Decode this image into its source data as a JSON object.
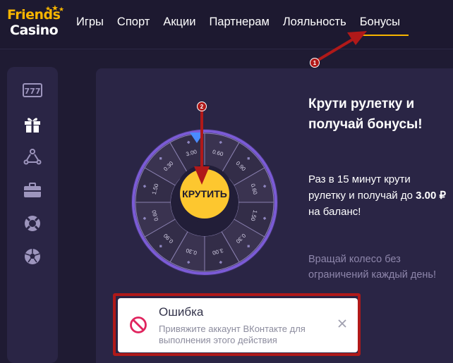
{
  "header": {
    "logo": {
      "line1": "Friends",
      "line2": "Casino"
    },
    "nav": [
      {
        "label": "Игры"
      },
      {
        "label": "Спорт"
      },
      {
        "label": "Акции"
      },
      {
        "label": "Партнерам"
      },
      {
        "label": "Лояльность"
      },
      {
        "label": "Бонусы",
        "active": true
      }
    ],
    "accent_color": "#f7b500"
  },
  "sidebar": {
    "items": [
      {
        "icon": "slots-777-icon"
      },
      {
        "icon": "gift-icon"
      },
      {
        "icon": "network-icon"
      },
      {
        "icon": "briefcase-icon"
      },
      {
        "icon": "lifebuoy-icon"
      },
      {
        "icon": "soccer-ball-icon"
      }
    ]
  },
  "wheel": {
    "spin_label": "КРУТИТЬ",
    "segments": [
      "0.60",
      "0.90",
      "0.60",
      "1.50",
      "0.30",
      "3.00",
      "0.30",
      "0.90",
      "0.60",
      "1.50",
      "0.30",
      "3.00"
    ],
    "button_color": "#fdc72f",
    "pointer_color": "#4a8cff"
  },
  "promo": {
    "title": "Крути рулетку и получай бонусы!",
    "text_before": "Раз в 15 минут крути рулетку и получай до ",
    "amount": "3.00 ₽",
    "text_after": " на баланс!",
    "sub": "Вращай колесо без ограничений каждый день!"
  },
  "toast": {
    "title": "Ошибка",
    "message": "Привяжите аккаунт ВКонтакте для выполнения этого действия",
    "icon": "prohibited-icon",
    "close_icon": "close-icon"
  },
  "annotations": {
    "badge1": "1",
    "badge2": "2",
    "color": "#b01919"
  }
}
